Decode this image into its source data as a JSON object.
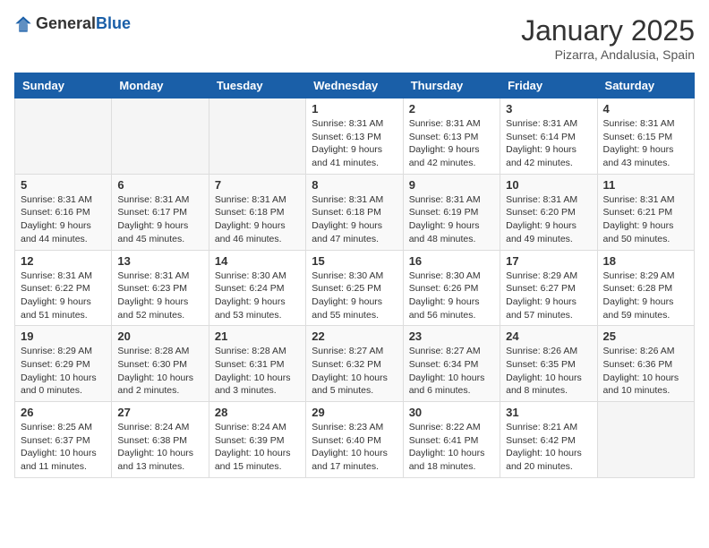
{
  "header": {
    "logo_general": "General",
    "logo_blue": "Blue",
    "title": "January 2025",
    "subtitle": "Pizarra, Andalusia, Spain"
  },
  "days_of_week": [
    "Sunday",
    "Monday",
    "Tuesday",
    "Wednesday",
    "Thursday",
    "Friday",
    "Saturday"
  ],
  "weeks": [
    [
      {
        "day": "",
        "info": ""
      },
      {
        "day": "",
        "info": ""
      },
      {
        "day": "",
        "info": ""
      },
      {
        "day": "1",
        "info": "Sunrise: 8:31 AM\nSunset: 6:13 PM\nDaylight: 9 hours and 41 minutes."
      },
      {
        "day": "2",
        "info": "Sunrise: 8:31 AM\nSunset: 6:13 PM\nDaylight: 9 hours and 42 minutes."
      },
      {
        "day": "3",
        "info": "Sunrise: 8:31 AM\nSunset: 6:14 PM\nDaylight: 9 hours and 42 minutes."
      },
      {
        "day": "4",
        "info": "Sunrise: 8:31 AM\nSunset: 6:15 PM\nDaylight: 9 hours and 43 minutes."
      }
    ],
    [
      {
        "day": "5",
        "info": "Sunrise: 8:31 AM\nSunset: 6:16 PM\nDaylight: 9 hours and 44 minutes."
      },
      {
        "day": "6",
        "info": "Sunrise: 8:31 AM\nSunset: 6:17 PM\nDaylight: 9 hours and 45 minutes."
      },
      {
        "day": "7",
        "info": "Sunrise: 8:31 AM\nSunset: 6:18 PM\nDaylight: 9 hours and 46 minutes."
      },
      {
        "day": "8",
        "info": "Sunrise: 8:31 AM\nSunset: 6:18 PM\nDaylight: 9 hours and 47 minutes."
      },
      {
        "day": "9",
        "info": "Sunrise: 8:31 AM\nSunset: 6:19 PM\nDaylight: 9 hours and 48 minutes."
      },
      {
        "day": "10",
        "info": "Sunrise: 8:31 AM\nSunset: 6:20 PM\nDaylight: 9 hours and 49 minutes."
      },
      {
        "day": "11",
        "info": "Sunrise: 8:31 AM\nSunset: 6:21 PM\nDaylight: 9 hours and 50 minutes."
      }
    ],
    [
      {
        "day": "12",
        "info": "Sunrise: 8:31 AM\nSunset: 6:22 PM\nDaylight: 9 hours and 51 minutes."
      },
      {
        "day": "13",
        "info": "Sunrise: 8:31 AM\nSunset: 6:23 PM\nDaylight: 9 hours and 52 minutes."
      },
      {
        "day": "14",
        "info": "Sunrise: 8:30 AM\nSunset: 6:24 PM\nDaylight: 9 hours and 53 minutes."
      },
      {
        "day": "15",
        "info": "Sunrise: 8:30 AM\nSunset: 6:25 PM\nDaylight: 9 hours and 55 minutes."
      },
      {
        "day": "16",
        "info": "Sunrise: 8:30 AM\nSunset: 6:26 PM\nDaylight: 9 hours and 56 minutes."
      },
      {
        "day": "17",
        "info": "Sunrise: 8:29 AM\nSunset: 6:27 PM\nDaylight: 9 hours and 57 minutes."
      },
      {
        "day": "18",
        "info": "Sunrise: 8:29 AM\nSunset: 6:28 PM\nDaylight: 9 hours and 59 minutes."
      }
    ],
    [
      {
        "day": "19",
        "info": "Sunrise: 8:29 AM\nSunset: 6:29 PM\nDaylight: 10 hours and 0 minutes."
      },
      {
        "day": "20",
        "info": "Sunrise: 8:28 AM\nSunset: 6:30 PM\nDaylight: 10 hours and 2 minutes."
      },
      {
        "day": "21",
        "info": "Sunrise: 8:28 AM\nSunset: 6:31 PM\nDaylight: 10 hours and 3 minutes."
      },
      {
        "day": "22",
        "info": "Sunrise: 8:27 AM\nSunset: 6:32 PM\nDaylight: 10 hours and 5 minutes."
      },
      {
        "day": "23",
        "info": "Sunrise: 8:27 AM\nSunset: 6:34 PM\nDaylight: 10 hours and 6 minutes."
      },
      {
        "day": "24",
        "info": "Sunrise: 8:26 AM\nSunset: 6:35 PM\nDaylight: 10 hours and 8 minutes."
      },
      {
        "day": "25",
        "info": "Sunrise: 8:26 AM\nSunset: 6:36 PM\nDaylight: 10 hours and 10 minutes."
      }
    ],
    [
      {
        "day": "26",
        "info": "Sunrise: 8:25 AM\nSunset: 6:37 PM\nDaylight: 10 hours and 11 minutes."
      },
      {
        "day": "27",
        "info": "Sunrise: 8:24 AM\nSunset: 6:38 PM\nDaylight: 10 hours and 13 minutes."
      },
      {
        "day": "28",
        "info": "Sunrise: 8:24 AM\nSunset: 6:39 PM\nDaylight: 10 hours and 15 minutes."
      },
      {
        "day": "29",
        "info": "Sunrise: 8:23 AM\nSunset: 6:40 PM\nDaylight: 10 hours and 17 minutes."
      },
      {
        "day": "30",
        "info": "Sunrise: 8:22 AM\nSunset: 6:41 PM\nDaylight: 10 hours and 18 minutes."
      },
      {
        "day": "31",
        "info": "Sunrise: 8:21 AM\nSunset: 6:42 PM\nDaylight: 10 hours and 20 minutes."
      },
      {
        "day": "",
        "info": ""
      }
    ]
  ]
}
